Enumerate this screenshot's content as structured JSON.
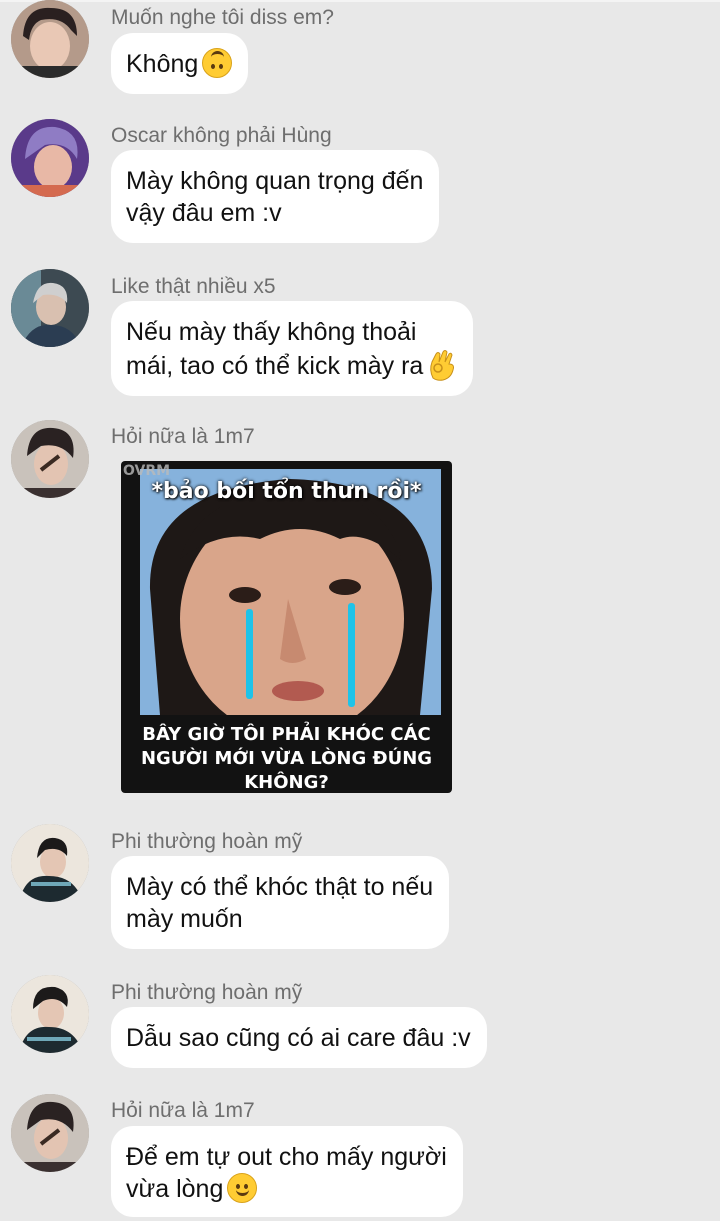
{
  "messages": [
    {
      "sender": "Muốn nghe tôi diss em?",
      "lines": [
        "Không"
      ],
      "emoji": "upside-down-face-emoji"
    },
    {
      "sender": "Oscar không phải Hùng",
      "lines": [
        "Mày không quan trọng đến",
        "vậy đâu em :v"
      ]
    },
    {
      "sender": "Like thật nhiều x5",
      "lines": [
        "Nếu mày thấy không thoải",
        "mái, tao có thể kick mày ra"
      ],
      "emoji": "ok-hand-emoji"
    },
    {
      "sender": "Hỏi nữa là 1m7",
      "meme": {
        "watermark": "OVRM",
        "top_caption": "*bảo bối tổn thưn rồi*",
        "bottom_caption_1": "BÂY GIỜ TÔI PHẢI KHÓC CÁC",
        "bottom_caption_2": "NGƯỜI MỚI VỪA LÒNG ĐÚNG",
        "bottom_caption_3": "KHÔNG?"
      }
    },
    {
      "sender": "Phi thường hoàn mỹ",
      "lines": [
        "Mày có thể khóc thật to nếu",
        "mày muốn"
      ]
    },
    {
      "sender": "Phi thường hoàn mỹ",
      "lines": [
        "Dẫu sao cũng có ai care đâu :v"
      ]
    },
    {
      "sender": "Hỏi nữa là 1m7",
      "lines": [
        "Để em tự out cho mấy người",
        "vừa lòng"
      ],
      "emoji": "smiling-face-emoji"
    }
  ],
  "colors": {
    "background": "#e8e8e8",
    "bubble": "#ffffff",
    "sender_text": "#6e6e6e",
    "message_text": "#111111"
  }
}
